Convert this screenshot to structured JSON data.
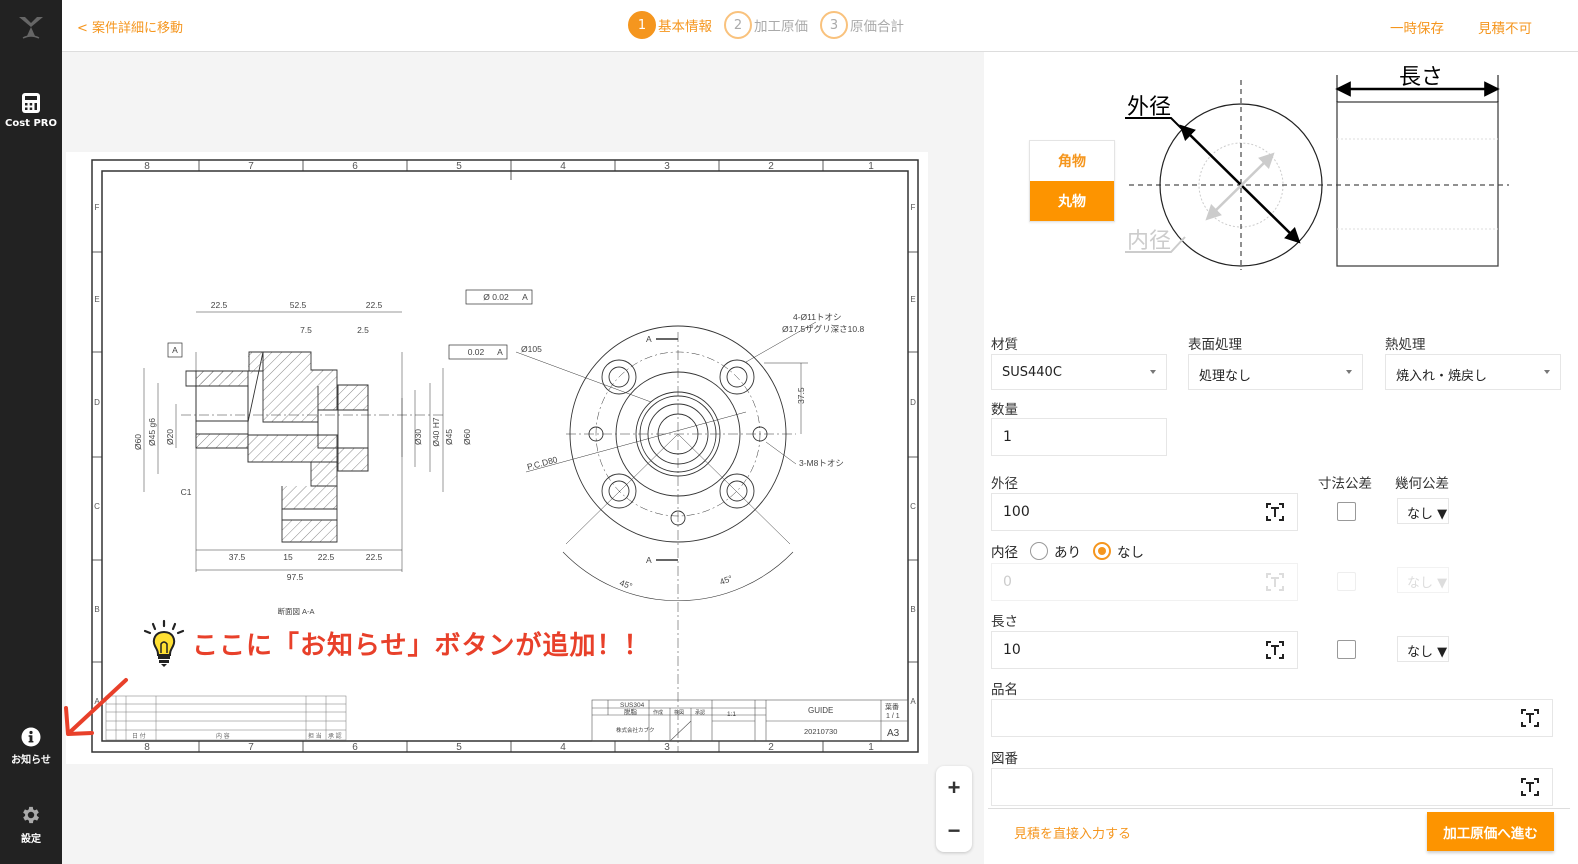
{
  "sidebar": {
    "logo": "logo-icon",
    "items": [
      {
        "label": "Cost PRO",
        "icon": "calculator-icon"
      },
      {
        "label": "お知らせ",
        "icon": "info-icon"
      },
      {
        "label": "設定",
        "icon": "gear-icon"
      }
    ]
  },
  "header": {
    "back_link": "< 案件詳細に移動",
    "steps": [
      {
        "num": "1",
        "label": "基本情報",
        "active": true
      },
      {
        "num": "2",
        "label": "加工原価",
        "active": false
      },
      {
        "num": "3",
        "label": "原価合計",
        "active": false
      }
    ],
    "actions": [
      "一時保存",
      "見積不可"
    ]
  },
  "drawing": {
    "col_labels": [
      "8",
      "7",
      "6",
      "5",
      "4",
      "3",
      "2",
      "1"
    ],
    "row_labels": [
      "F",
      "E",
      "D",
      "C",
      "B",
      "A"
    ],
    "section_label": "断面図 A-A",
    "dims_top": [
      "22.5",
      "52.5",
      "22.5"
    ],
    "dims_sub": [
      "7.5",
      "2.5"
    ],
    "dims_bottom": [
      "37.5",
      "15",
      "22.5",
      "22.5"
    ],
    "dim_total": "97.5",
    "dims_vertical_left": [
      "Ø60",
      "Ø45 g6",
      "Ø20"
    ],
    "dims_vertical_right": [
      "Ø30",
      "Ø40 H7",
      "Ø45",
      "Ø60"
    ],
    "chamfer": "C1",
    "datum": "A",
    "gdt_concentricity": [
      "Ø 0.02",
      "A"
    ],
    "gdt_perpendicularity": [
      "0.02",
      "A"
    ],
    "front_notes": {
      "diameter": "Ø105",
      "holes": "4-Ø11トオシ",
      "counterbore": "Ø17.5ザグリ深さ10.8",
      "height": "37.5",
      "pcd": "P.C.D80",
      "tapped": "3-M8トオシ",
      "angle_left": "45°",
      "angle_right": "45°",
      "section_mark": "A"
    },
    "title_block": {
      "material": "SUS304",
      "treatment": "脱脂",
      "company": "株式会社カブク",
      "scale": "1:1",
      "part_name": "GUIDE",
      "drawing_no": "20210730",
      "sheet": "1 / 1",
      "size": "A3",
      "sheet_label": "葉番",
      "roles": [
        "作成",
        "検図",
        "承認"
      ],
      "revision_headers": [
        "日 付",
        "内 容",
        "担 当",
        "承 認"
      ]
    },
    "zoom_in": "+",
    "zoom_out": "−"
  },
  "annotation": {
    "text": "ここに「お知らせ」ボタンが追加！！",
    "icon": "lightbulb-icon"
  },
  "panel": {
    "shape_options": [
      {
        "label": "角物",
        "selected": false
      },
      {
        "label": "丸物",
        "selected": true
      }
    ],
    "diagram_labels": {
      "outer": "外径",
      "inner": "内径",
      "length": "長さ"
    },
    "material": {
      "label": "材質",
      "value": "SUS440C"
    },
    "surface": {
      "label": "表面処理",
      "value": "処理なし"
    },
    "heat": {
      "label": "熱処理",
      "value": "焼入れ・焼戻し"
    },
    "quantity": {
      "label": "数量",
      "value": "1"
    },
    "tolerance_header": "寸法公差",
    "geometric_header": "幾何公差",
    "outer_diameter": {
      "label": "外径",
      "value": "100",
      "geo": "なし ▼"
    },
    "inner_diameter": {
      "label": "内径",
      "value": "0",
      "geo": "なし ▼",
      "options": [
        "あり",
        "なし"
      ],
      "selected": "なし"
    },
    "length": {
      "label": "長さ",
      "value": "10",
      "geo": "なし ▼"
    },
    "part_name": {
      "label": "品名",
      "value": ""
    },
    "drawing_number": {
      "label": "図番",
      "value": ""
    },
    "direct_input_link": "見積を直接入力する",
    "next_button": "加工原価へ進む"
  },
  "colors": {
    "accent": "#f5961e",
    "accent_button": "#fd9400",
    "sidebar_bg": "#222222",
    "annotation_red": "#e8402a"
  }
}
